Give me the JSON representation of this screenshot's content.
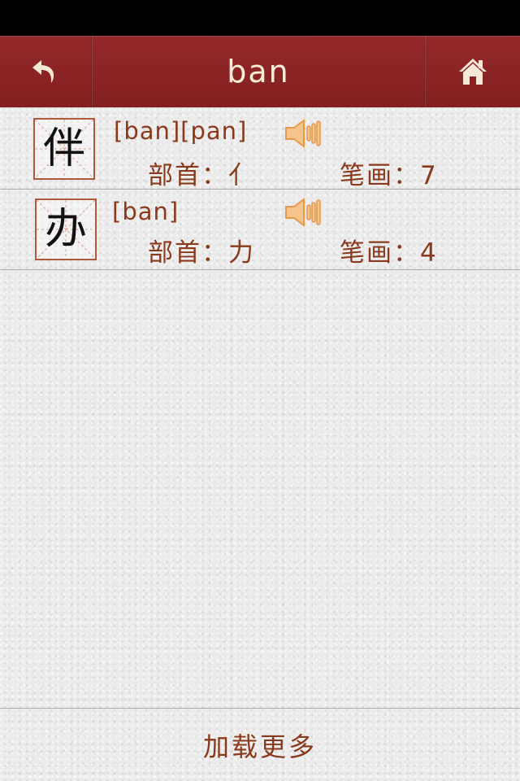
{
  "header": {
    "title": "ban",
    "back_icon": "back-arrow-icon",
    "home_icon": "home-icon"
  },
  "results": [
    {
      "character": "伴",
      "pinyin": "[ban][pan]",
      "radical_text": "部首：亻",
      "strokes_text": "笔画：7",
      "audio_icon": "speaker-icon"
    },
    {
      "character": "办",
      "pinyin": "[ban]",
      "radical_text": "部首：力",
      "strokes_text": "笔画：4",
      "audio_icon": "speaker-icon"
    }
  ],
  "footer": {
    "load_more_label": "加载更多"
  },
  "colors": {
    "nav_bar": "#8b2224",
    "nav_text": "#f7ecd8",
    "accent_text": "#8a3a1c",
    "char_border": "#b05a3c",
    "speaker": "#f2b36a"
  }
}
